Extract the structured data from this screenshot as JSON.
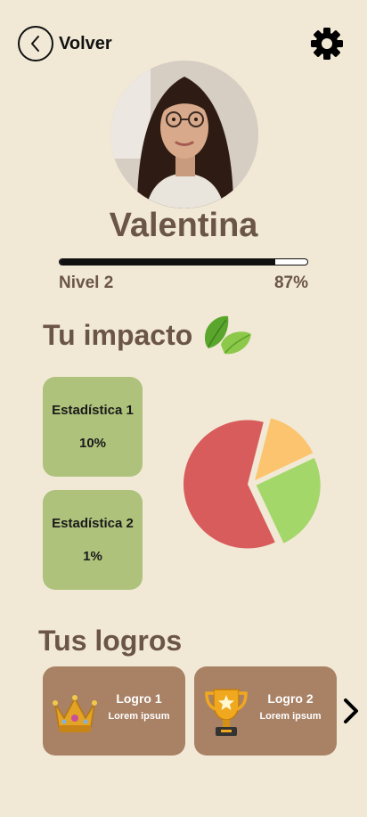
{
  "header": {
    "back_label": "Volver",
    "back_icon": "chevron-left-icon",
    "settings_icon": "gear-icon"
  },
  "profile": {
    "name": "Valentina",
    "level_label": "Nivel 2",
    "progress_percent_label": "87%",
    "progress": 0.87
  },
  "impact": {
    "title": "Tu impacto",
    "icon": "leaf-icon",
    "stats": [
      {
        "label": "Estadística 1",
        "value": "10%"
      },
      {
        "label": "Estadística 2",
        "value": "1%"
      }
    ]
  },
  "chart_data": {
    "type": "pie",
    "slices": [
      {
        "value": 61,
        "color": "#d95c5c"
      },
      {
        "value": 14,
        "color": "#fcc46f"
      },
      {
        "value": 25,
        "color": "#a4d76a"
      }
    ]
  },
  "achievements": {
    "title": "Tus logros",
    "items": [
      {
        "title": "Logro 1",
        "subtitle": "Lorem ipsum",
        "icon": "crown-icon"
      },
      {
        "title": "Logro 2",
        "subtitle": "Lorem ipsum",
        "icon": "trophy-icon"
      }
    ],
    "next_icon": "chevron-right-icon"
  },
  "colors": {
    "background": "#f1e9d6",
    "text_brown": "#6b5548",
    "stat_card": "#aec27b",
    "achievement_card": "#a98165"
  }
}
